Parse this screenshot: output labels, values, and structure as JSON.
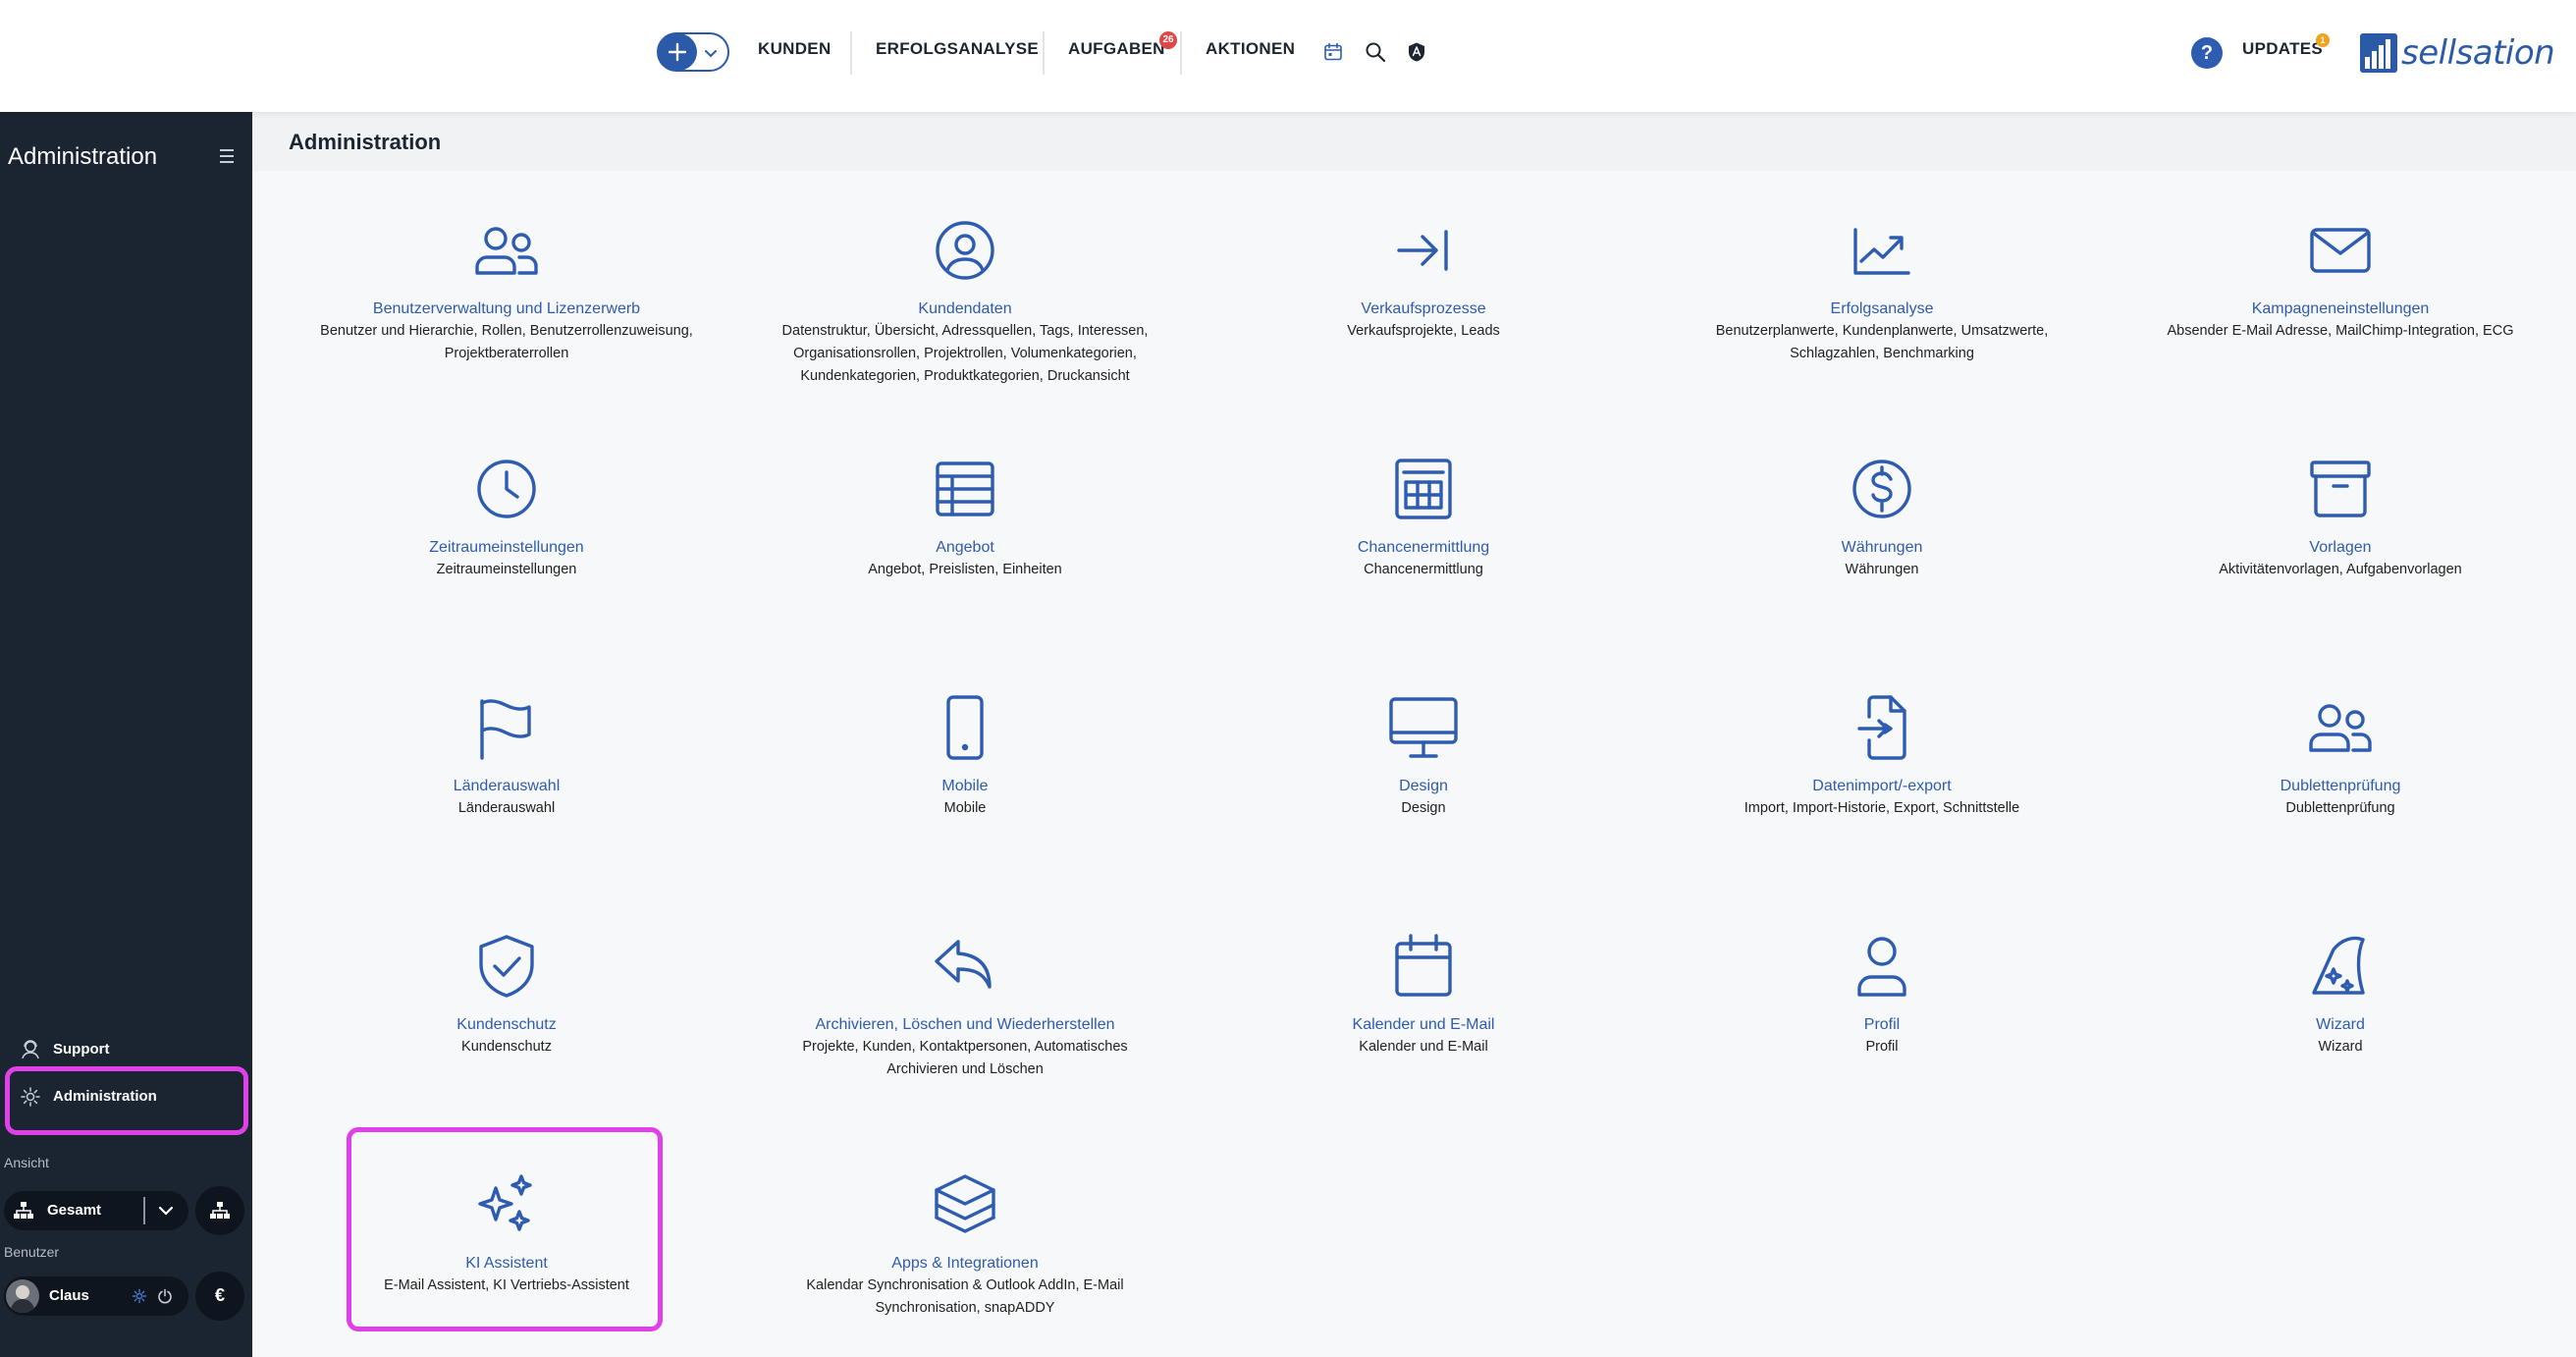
{
  "topbar": {
    "nav": [
      "KUNDEN",
      "ERFOLGSANALYSE",
      "AUFGABEN",
      "AKTIONEN"
    ],
    "tasks_badge": "26",
    "updates_label": "UPDATES",
    "updates_badge": "1",
    "help_glyph": "?",
    "brand": "sellsation",
    "icons": [
      "plus-icon",
      "chevron-down-icon",
      "calendar-icon",
      "search-icon",
      "shield-icon",
      "help-icon"
    ]
  },
  "sidebar": {
    "title": "Administration",
    "support_label": "Support",
    "admin_label": "Administration",
    "view_section": "Ansicht",
    "view_value": "Gesamt",
    "user_section": "Benutzer",
    "user_name": "Claus",
    "currency_symbol": "€"
  },
  "main": {
    "title": "Administration",
    "tiles": [
      {
        "title": "Benutzerverwaltung und Lizenzerwerb",
        "desc": "Benutzer und Hierarchie, Rollen, Benutzerrollenzuweisung, Projektberaterrollen",
        "icon": "users-icon"
      },
      {
        "title": "Kundendaten",
        "desc": "Datenstruktur, Übersicht, Adressquellen, Tags, Interessen, Organisationsrollen, Projektrollen, Volumenkategorien, Kundenkategorien, Produktkategorien, Druckansicht",
        "icon": "user-circle-icon"
      },
      {
        "title": "Verkaufsprozesse",
        "desc": "Verkaufsprojekte, Leads",
        "icon": "arrow-to-line-icon"
      },
      {
        "title": "Erfolgsanalyse",
        "desc": "Benutzerplanwerte, Kundenplanwerte, Umsatzwerte, Schlagzahlen, Benchmarking",
        "icon": "chart-line-icon"
      },
      {
        "title": "Kampagneneinstellungen",
        "desc": "Absender E-Mail Adresse, MailChimp-Integration, ECG",
        "icon": "envelope-icon"
      },
      {
        "title": "Zeitraumeinstellungen",
        "desc": "Zeitraumeinstellungen",
        "icon": "clock-icon"
      },
      {
        "title": "Angebot",
        "desc": "Angebot, Preislisten, Einheiten",
        "icon": "table-icon"
      },
      {
        "title": "Chancenermittlung",
        "desc": "Chancenermittlung",
        "icon": "calculator-icon"
      },
      {
        "title": "Währungen",
        "desc": "Währungen",
        "icon": "dollar-circle-icon"
      },
      {
        "title": "Vorlagen",
        "desc": "Aktivitätenvorlagen, Aufgabenvorlagen",
        "icon": "archive-box-icon"
      },
      {
        "title": "Länderauswahl",
        "desc": "Länderauswahl",
        "icon": "flag-icon"
      },
      {
        "title": "Mobile",
        "desc": "Mobile",
        "icon": "smartphone-icon"
      },
      {
        "title": "Design",
        "desc": "Design",
        "icon": "monitor-icon"
      },
      {
        "title": "Datenimport/-export",
        "desc": "Import, Import-Historie, Export, Schnittstelle",
        "icon": "file-import-icon"
      },
      {
        "title": "Dublettenprüfung",
        "desc": "Dublettenprüfung",
        "icon": "users-duplicate-icon"
      },
      {
        "title": "Kundenschutz",
        "desc": "Kundenschutz",
        "icon": "shield-check-icon"
      },
      {
        "title": "Archivieren, Löschen und Wiederherstellen",
        "desc": "Projekte, Kunden, Kontaktpersonen, Automatisches Archivieren und Löschen",
        "icon": "reply-arrow-icon"
      },
      {
        "title": "Kalender und E-Mail",
        "desc": "Kalender und E-Mail",
        "icon": "calendar-icon"
      },
      {
        "title": "Profil",
        "desc": "Profil",
        "icon": "user-icon"
      },
      {
        "title": "Wizard",
        "desc": "Wizard",
        "icon": "wizard-hat-icon"
      },
      {
        "title": "KI Assistent",
        "desc": "E-Mail Assistent, KI Vertriebs-Assistent",
        "icon": "sparkles-icon"
      },
      {
        "title": "Apps & Integrationen",
        "desc": "Kalendar Synchronisation & Outlook AddIn, E-Mail Synchronisation, snapADDY",
        "icon": "layers-icon"
      }
    ]
  },
  "colors": {
    "accent": "#2e5cb0",
    "sidebar_bg": "#1b2431",
    "highlight": "#e040e8"
  }
}
